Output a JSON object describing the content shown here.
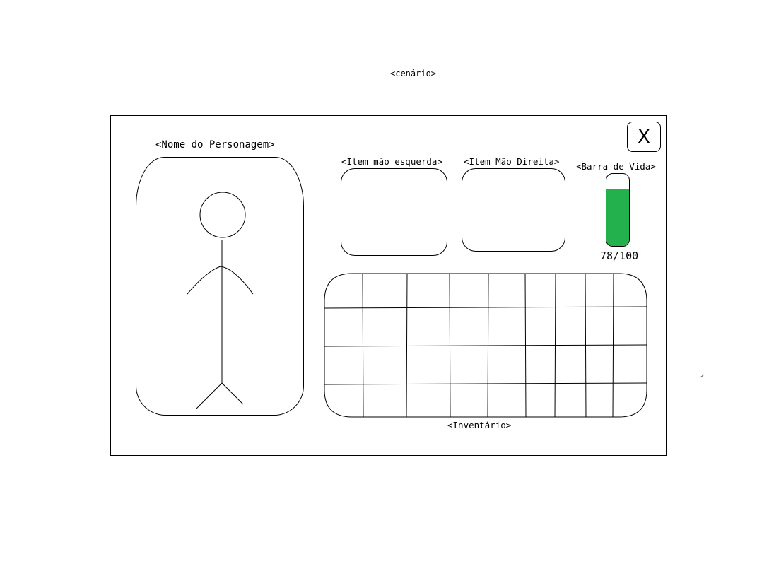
{
  "scene": {
    "label": "<cenário>"
  },
  "close_button": {
    "label": "X"
  },
  "character": {
    "name": "<Nome do Personagem>"
  },
  "equipment": {
    "left_hand_label": "<Item mão esquerda>",
    "right_hand_label": "<Item Mão Direita>"
  },
  "health": {
    "label": "<Barra de Vida>",
    "current": 78,
    "max": 100,
    "display": "78/100",
    "fill_color": "#22b14c"
  },
  "inventory": {
    "label": "<Inventário>",
    "rows": 4,
    "columns": 9
  }
}
